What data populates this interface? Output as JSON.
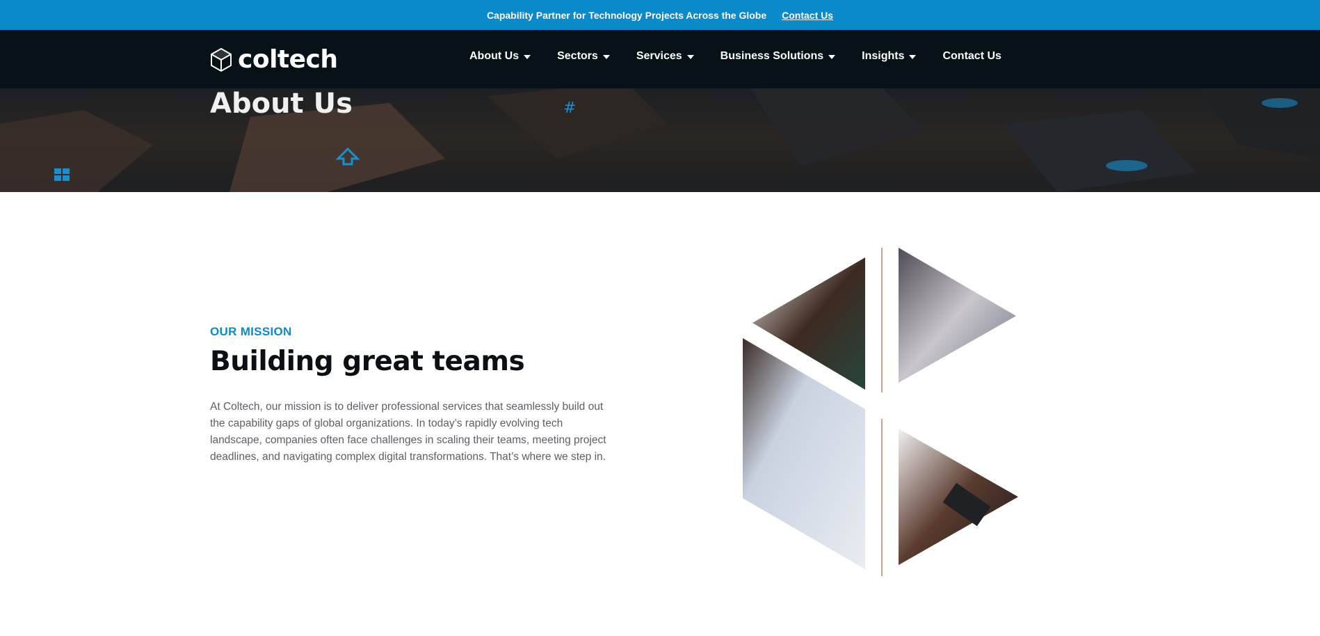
{
  "topbar": {
    "message": "Capability Partner for Technology Projects Across the Globe",
    "link": "Contact Us"
  },
  "header": {
    "logo_text": "coltech",
    "nav": [
      {
        "label": "About Us",
        "dropdown": true
      },
      {
        "label": "Sectors",
        "dropdown": true
      },
      {
        "label": "Services",
        "dropdown": true
      },
      {
        "label": "Business Solutions",
        "dropdown": true
      },
      {
        "label": "Insights",
        "dropdown": true
      },
      {
        "label": "Contact Us",
        "dropdown": false
      }
    ]
  },
  "hero": {
    "title": "About Us"
  },
  "mission": {
    "eyebrow": "OUR MISSION",
    "headline": "Building great teams",
    "body": "At Coltech, our mission is to deliver professional services that seamlessly build out the capability gaps of global organizations. In today’s rapidly evolving tech landscape, companies often face challenges in scaling their teams, meeting project deadlines, and navigating complex digital transformations. That’s where we step in."
  },
  "colors": {
    "accent": "#0a8acb",
    "nav_bg": "#071218",
    "heading": "#0c1014",
    "body_text": "#5c6066"
  }
}
